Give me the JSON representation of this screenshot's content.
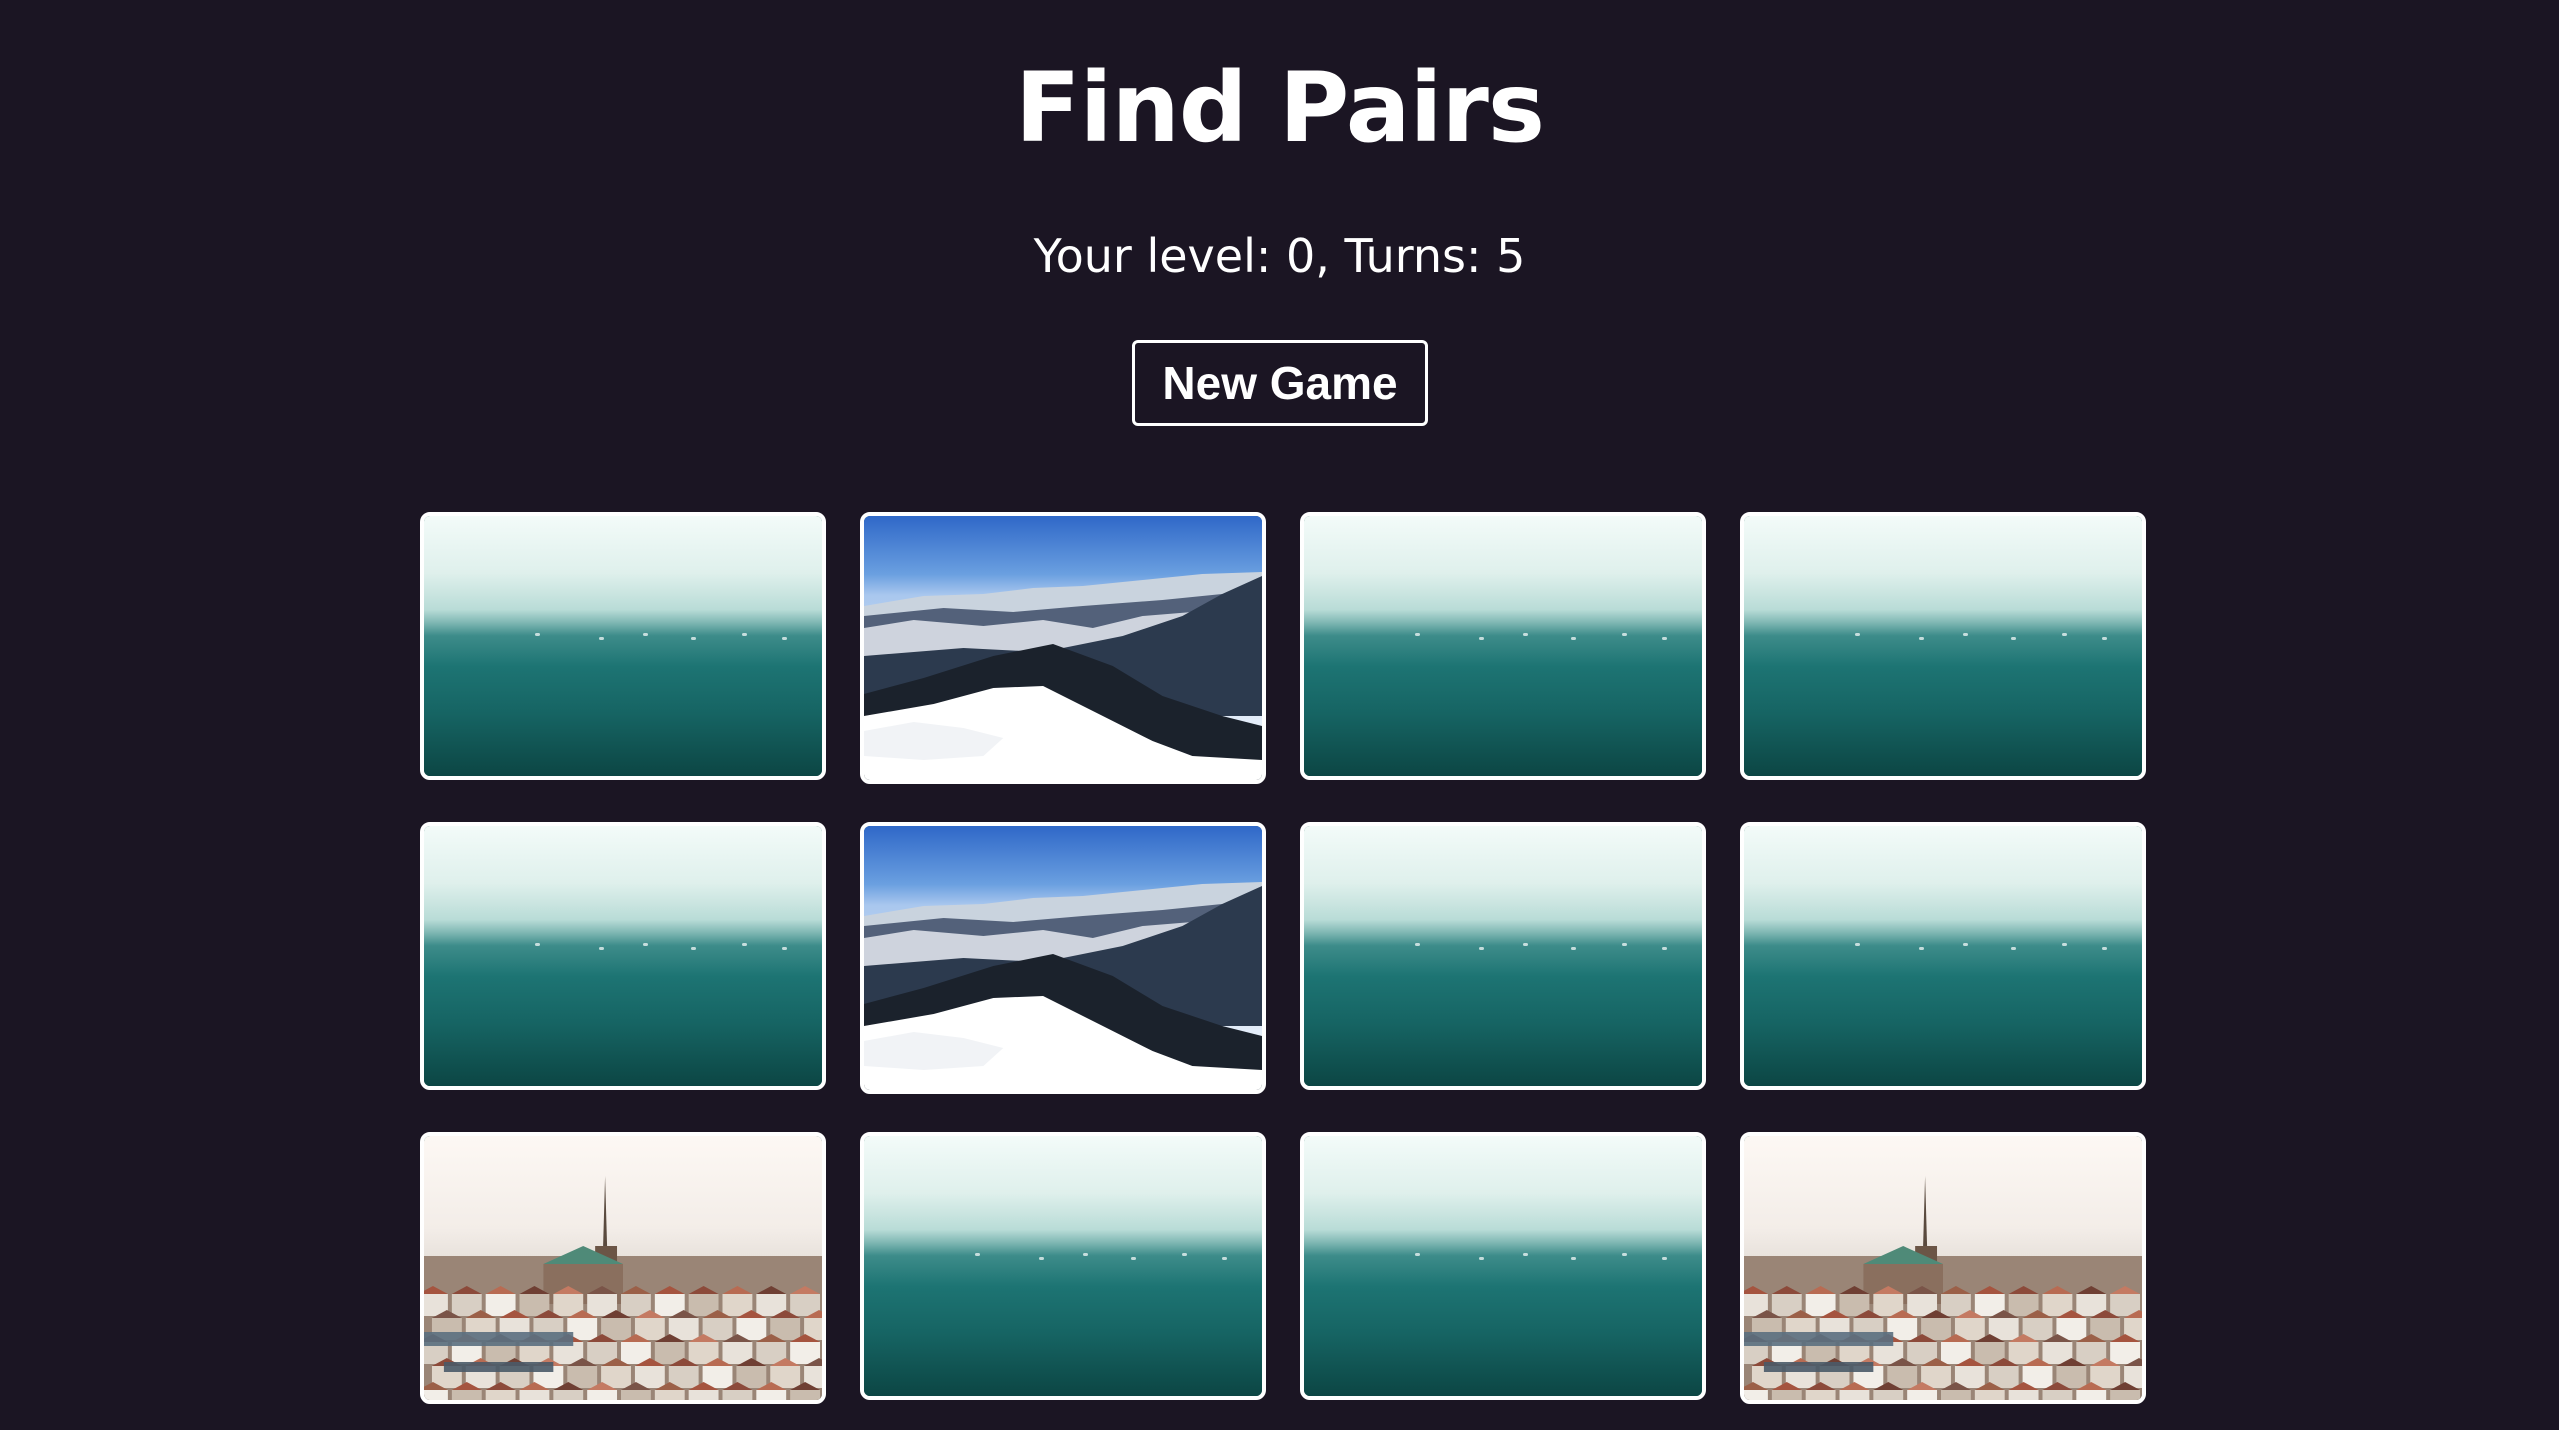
{
  "header": {
    "title": "Find Pairs",
    "status": "Your level: 0, Turns: 5",
    "new_game_label": "New Game"
  },
  "colors": {
    "background": "#1b1523",
    "text": "#ffffff",
    "card_border": "#ffffff",
    "sea_teal": "#166463"
  },
  "board": {
    "rows": 3,
    "columns": 4,
    "cards": [
      {
        "state": "face-down",
        "image": "sea-card-back"
      },
      {
        "state": "face-up",
        "image": "snowy-mountain-photo"
      },
      {
        "state": "face-down",
        "image": "sea-card-back"
      },
      {
        "state": "face-down",
        "image": "sea-card-back"
      },
      {
        "state": "face-down",
        "image": "sea-card-back"
      },
      {
        "state": "face-up",
        "image": "snowy-mountain-photo"
      },
      {
        "state": "face-down",
        "image": "sea-card-back"
      },
      {
        "state": "face-down",
        "image": "sea-card-back"
      },
      {
        "state": "face-up",
        "image": "city-cathedral-photo"
      },
      {
        "state": "face-down",
        "image": "sea-card-back"
      },
      {
        "state": "face-down",
        "image": "sea-card-back"
      },
      {
        "state": "face-up",
        "image": "city-cathedral-photo"
      }
    ]
  }
}
